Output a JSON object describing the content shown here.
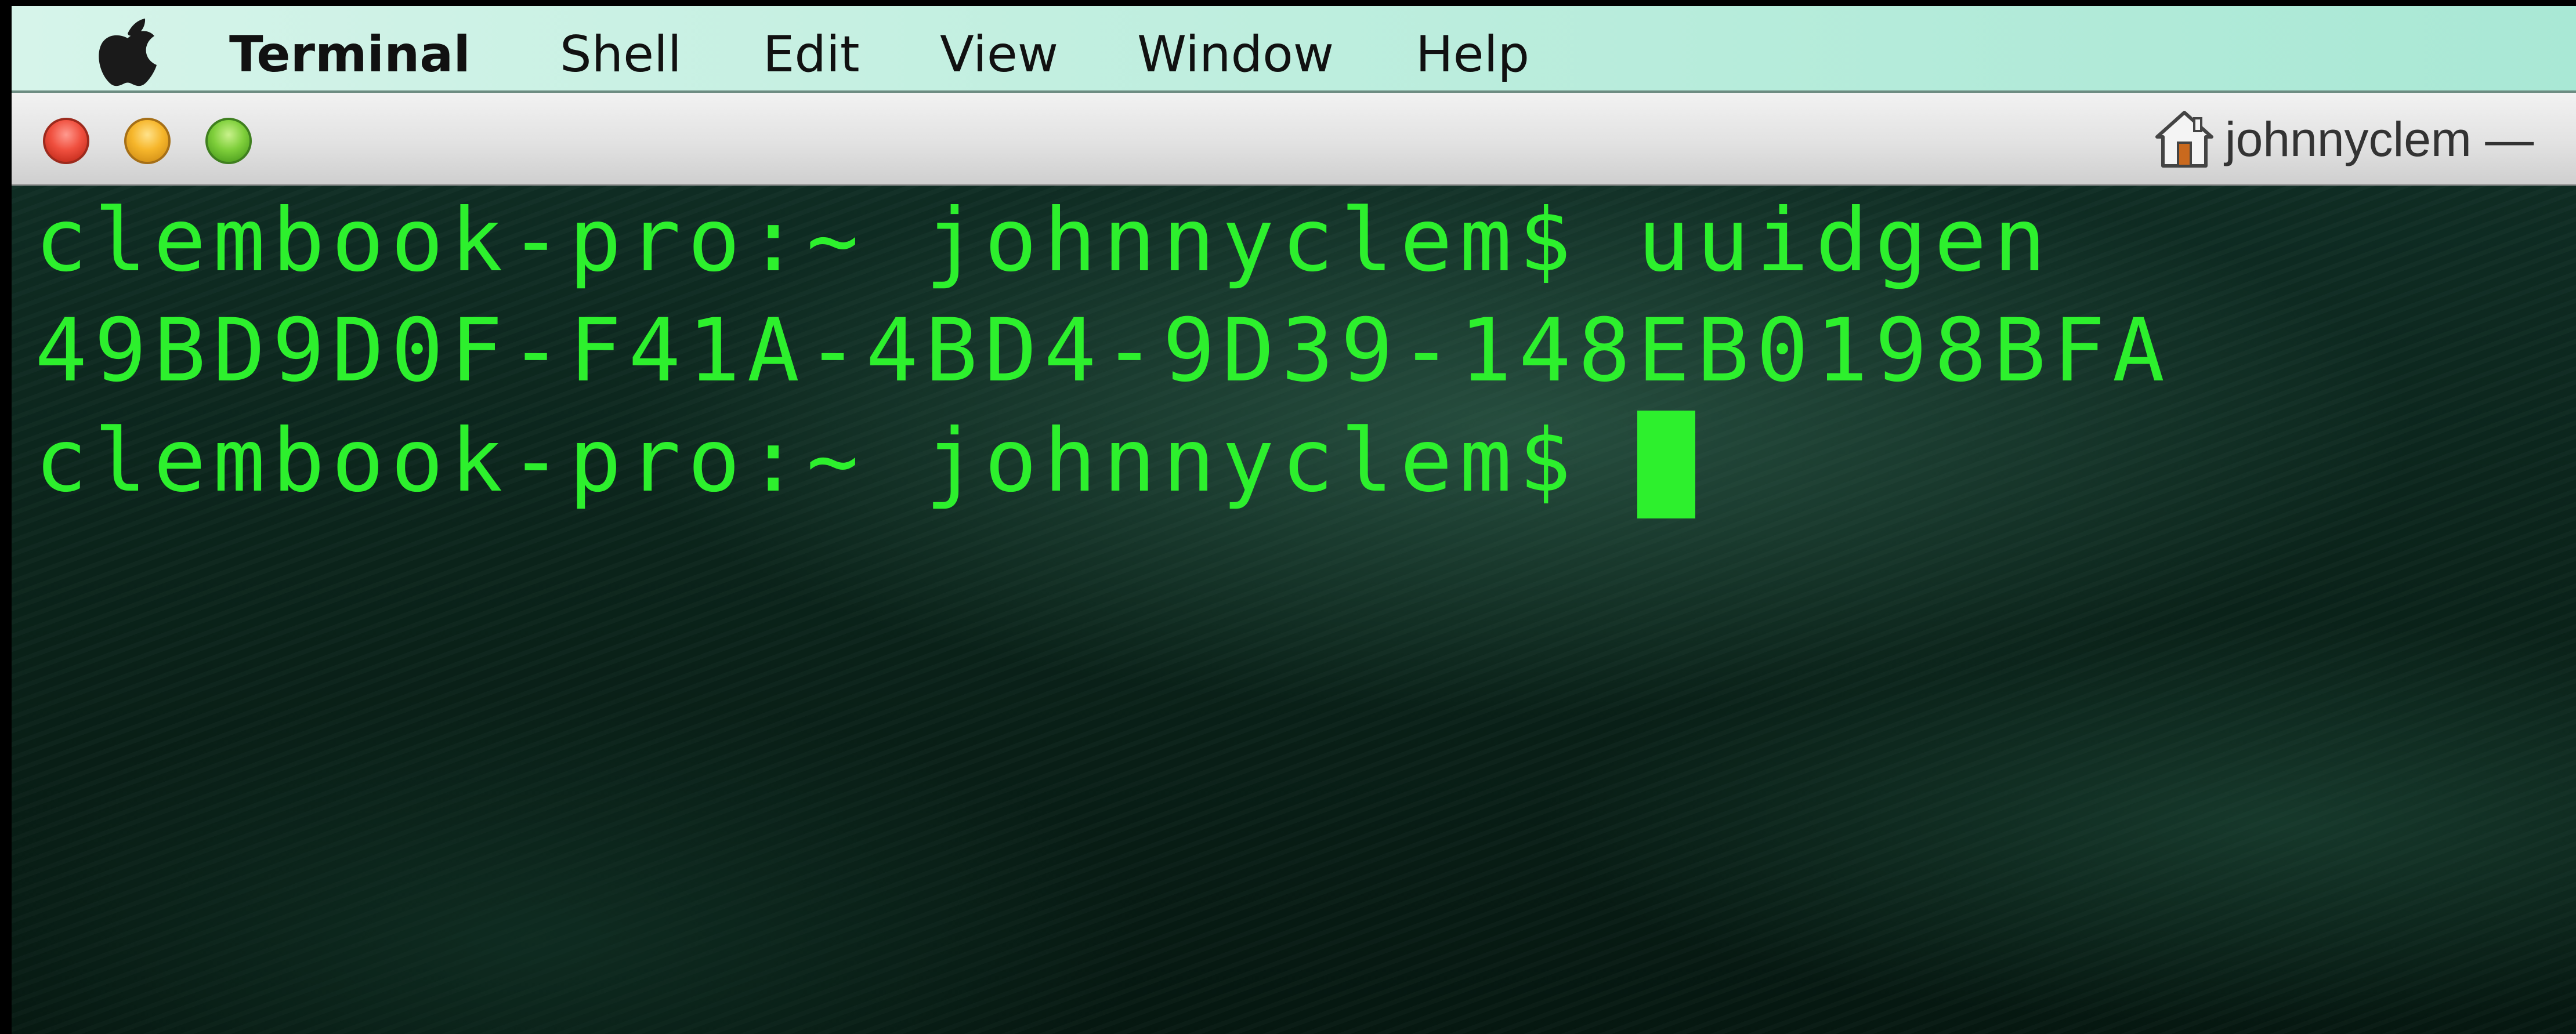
{
  "menubar": {
    "apple_icon": "apple-logo-icon",
    "items": [
      "Terminal",
      "Shell",
      "Edit",
      "View",
      "Window",
      "Help"
    ]
  },
  "window": {
    "title": "johnnyclem —",
    "title_icon": "home-icon",
    "buttons": [
      "close",
      "minimize",
      "zoom"
    ]
  },
  "terminal": {
    "prompt": "clembook-pro:~ johnnyclem$ ",
    "lines": [
      "clembook-pro:~ johnnyclem$ uuidgen",
      "49BD9D0F-F41A-4BD4-9D39-148EB0198BFA",
      "clembook-pro:~ johnnyclem$ "
    ],
    "text_color": "#2df02d"
  }
}
